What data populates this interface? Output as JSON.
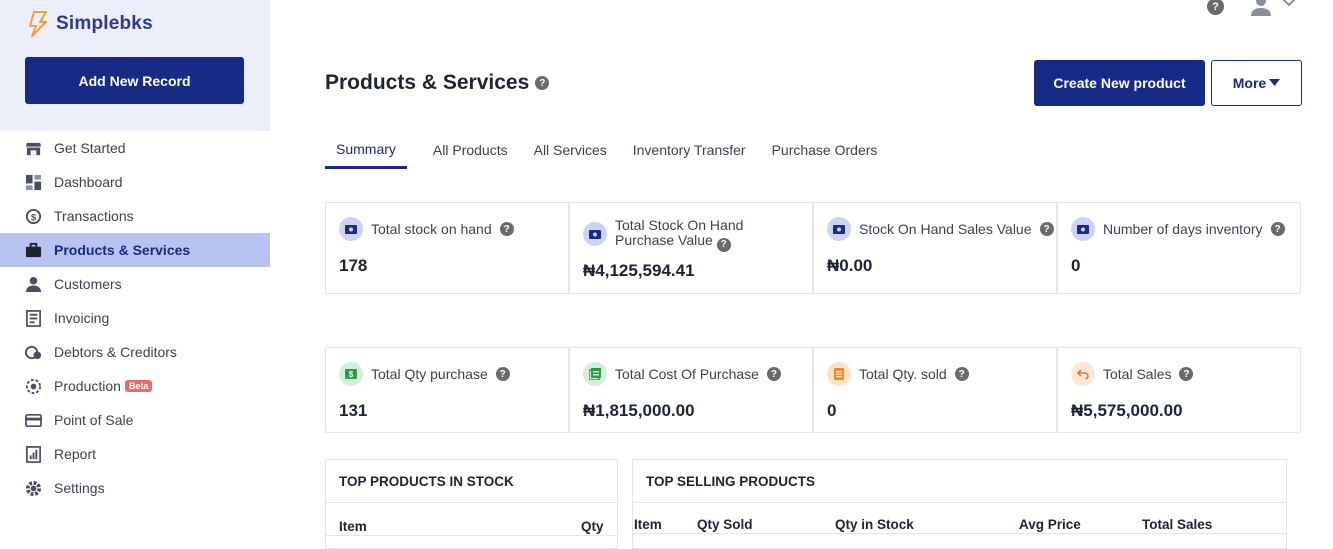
{
  "app": {
    "name": "Simplebks"
  },
  "sidebar": {
    "add_label": "Add New Record",
    "items": [
      {
        "label": "Get Started",
        "icon": "store-icon"
      },
      {
        "label": "Dashboard",
        "icon": "dashboard-icon"
      },
      {
        "label": "Transactions",
        "icon": "transactions-icon"
      },
      {
        "label": "Products & Services",
        "icon": "briefcase-icon"
      },
      {
        "label": "Customers",
        "icon": "user-icon"
      },
      {
        "label": "Invoicing",
        "icon": "invoice-icon"
      },
      {
        "label": "Debtors & Creditors",
        "icon": "debtors-icon"
      },
      {
        "label": "Production",
        "icon": "production-icon",
        "badge": "Beta"
      },
      {
        "label": "Point of Sale",
        "icon": "card-icon"
      },
      {
        "label": "Report",
        "icon": "report-icon"
      },
      {
        "label": "Settings",
        "icon": "gear-icon"
      }
    ],
    "active_index": 3
  },
  "header": {
    "help": "?",
    "title": "Products & Services",
    "create_label": "Create New product",
    "more_label": "More"
  },
  "tabs": [
    "Summary",
    "All Products",
    "All Services",
    "Inventory Transfer",
    "Purchase Orders"
  ],
  "stats_row1": [
    {
      "label": "Total stock on hand",
      "value": "178",
      "icon": "cash-icon"
    },
    {
      "label": "Total Stock On Hand Purchase Value",
      "value": "₦4,125,594.41",
      "icon": "cash-icon"
    },
    {
      "label": "Stock On Hand Sales Value",
      "value": "₦0.00",
      "icon": "cash-icon"
    },
    {
      "label": "Number of days inventory",
      "value": "0",
      "icon": "cash-icon"
    }
  ],
  "stats_row2": [
    {
      "label": "Total Qty purchase",
      "value": "131",
      "icon": "dollar-icon"
    },
    {
      "label": "Total Cost Of Purchase",
      "value": "₦1,815,000.00",
      "icon": "receipt-icon"
    },
    {
      "label": "Total Qty. sold",
      "value": "0",
      "icon": "list-icon"
    },
    {
      "label": "Total Sales",
      "value": "₦5,575,000.00",
      "icon": "undo-icon"
    }
  ],
  "top_stock": {
    "title": "TOP PRODUCTS IN STOCK",
    "columns": [
      "Item",
      "Qty"
    ]
  },
  "top_selling": {
    "title": "TOP SELLING PRODUCTS",
    "columns": [
      "Item",
      "Qty Sold",
      "Qty in Stock",
      "Avg Price",
      "Total Sales"
    ]
  },
  "colors": {
    "primary": "#172a86",
    "active_bg": "#b9c3f2",
    "sidebar_top": "#eceef9",
    "beta": "#e66b6b"
  }
}
